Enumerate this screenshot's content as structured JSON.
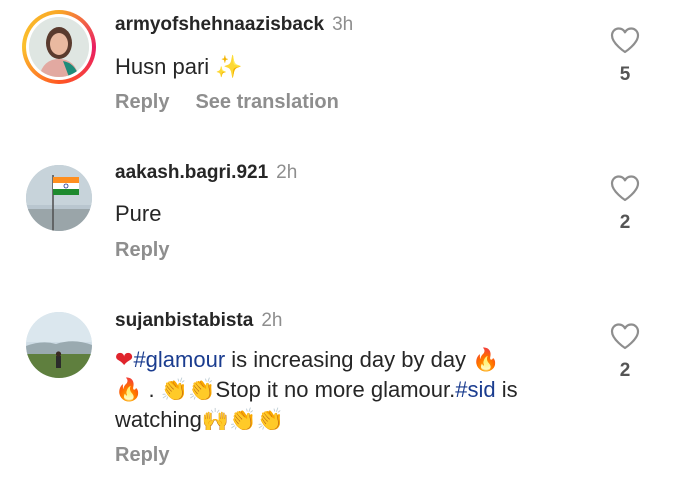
{
  "comments": [
    {
      "username": "armyofshehnaazisback",
      "time": "3h",
      "text": "Husn pari",
      "emoji": "✨",
      "reply": "Reply",
      "translate": "See translation",
      "likes": "5"
    },
    {
      "username": "aakash.bagri.921",
      "time": "2h",
      "text": "Pure",
      "reply": "Reply",
      "likes": "2"
    },
    {
      "username": "sujanbistabista",
      "time": "2h",
      "text_parts": [
        "❤",
        "#glamour",
        " is increasing day by day ",
        "🔥",
        "🔥",
        " . ",
        "👏👏",
        "Stop it no more glamour.",
        "#sid",
        " is watching",
        "🙌👏👏"
      ],
      "reply": "Reply",
      "likes": "2"
    }
  ],
  "colors": {
    "text": "#262626",
    "muted": "#8e8e8e",
    "hashtag": "#1a3c8f"
  }
}
